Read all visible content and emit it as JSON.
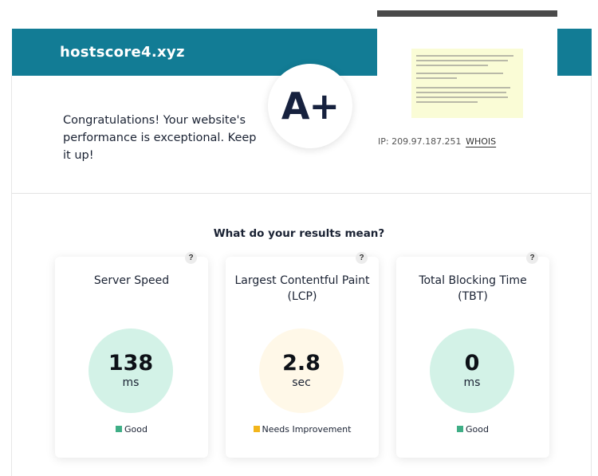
{
  "site": {
    "name": "hostscore4.xyz"
  },
  "grade": "A+",
  "message": "Congratulations! Your website's performance is exceptional. Keep it up!",
  "ip": {
    "label": "IP: 209.97.187.251",
    "whois": "WHOIS"
  },
  "results_title": "What do your results mean?",
  "help_icon": "?",
  "colors": {
    "banner": "#127c95",
    "good": "#3fae86",
    "good_bg": "#d3f2e7",
    "needs": "#f2b51c",
    "needs_bg": "#fff8e8"
  },
  "metrics": [
    {
      "title": "Server Speed",
      "value": "138",
      "unit": "ms",
      "status": "Good",
      "rating": "good"
    },
    {
      "title": "Largest Contentful Paint (LCP)",
      "value": "2.8",
      "unit": "sec",
      "status": "Needs Improvement",
      "rating": "needs-improvement"
    },
    {
      "title": "Total Blocking Time (TBT)",
      "value": "0",
      "unit": "ms",
      "status": "Good",
      "rating": "good"
    }
  ]
}
